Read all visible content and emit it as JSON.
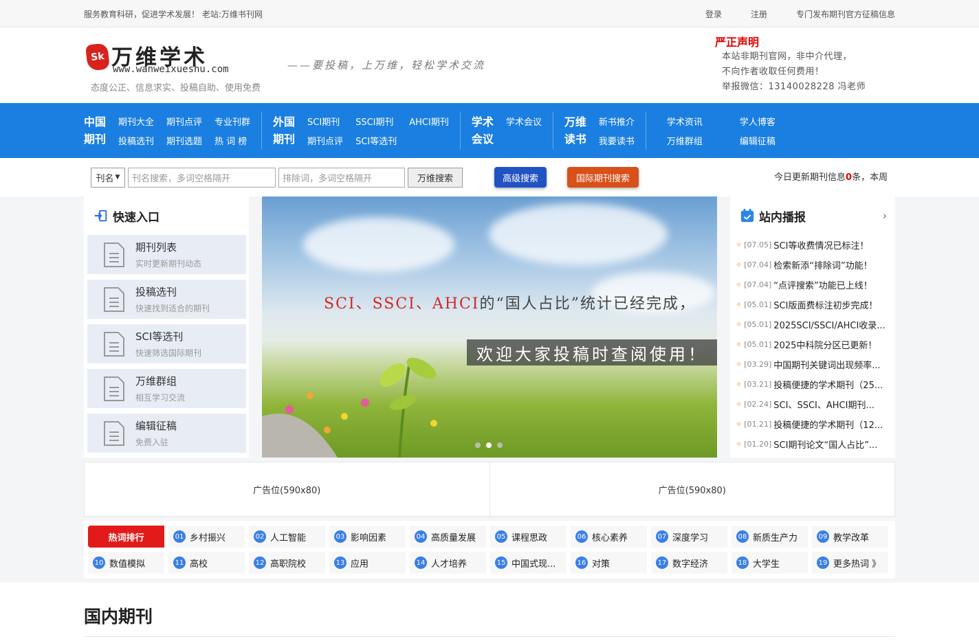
{
  "topbar": {
    "slogan": "服务教育科研，促进学术发展！ 老站:万维书刊网",
    "login": "登录",
    "register": "注册",
    "official": "专门发布期刊官方征稿信息"
  },
  "header": {
    "logo_badge": "Sk",
    "logo_title": "万维学术",
    "logo_url": "www.wanweixueshu.com",
    "logo_slogan": "态度公正、信息求实、投稿自助、使用免费",
    "tagline": "——要投稿，上万维，轻松学术交流",
    "notice_title": "严正声明",
    "notice_lines": [
      "本站非期刊官网，非中介代理，",
      "不向作者收取任何费用！",
      "举报微信：13140028228 冯老师"
    ]
  },
  "nav": {
    "groups": [
      {
        "cat": [
          "中国",
          "期刊"
        ],
        "links": [
          "期刊大全",
          "投稿选刊",
          "期刊点评",
          "期刊选题",
          "专业刊群",
          "热 词 榜"
        ]
      },
      {
        "cat": [
          "外国",
          "期刊"
        ],
        "links": [
          "SCI期刊",
          "期刊点评",
          "SSCI期刊",
          "SCI等选刊",
          "AHCI期刊",
          ""
        ]
      },
      {
        "cat": [
          "学术",
          "会议"
        ],
        "links": [
          "学术会议",
          ""
        ]
      },
      {
        "cat": [
          "万维",
          "读书"
        ],
        "links": [
          "新书推介",
          "我要读书"
        ]
      }
    ],
    "solo": [
      [
        "学术资讯",
        "万维群组"
      ],
      [
        "学人博客",
        "编辑征稿"
      ]
    ]
  },
  "search": {
    "select_value": "刊名",
    "keyword_placeholder": "刊名搜索，多词空格隔开",
    "exclude_placeholder": "排除词，多词空格隔开",
    "search_button": "万维搜索",
    "advanced_button": "高级搜索",
    "intl_button": "国际期刊搜索",
    "update_prefix": "今日更新期刊信息",
    "update_count": "0",
    "update_suffix": "条，本周"
  },
  "quick": {
    "title": "快速入口",
    "items": [
      {
        "title": "期刊列表",
        "sub": "实时更新期刊动态"
      },
      {
        "title": "投稿选刊",
        "sub": "快速找到适合的期刊"
      },
      {
        "title": "SCI等选刊",
        "sub": "快速筛选国际期刊"
      },
      {
        "title": "万维群组",
        "sub": "相互学习交流"
      },
      {
        "title": "编辑征稿",
        "sub": "免费入驻"
      }
    ]
  },
  "banner": {
    "line1_highlight": "SCI、SSCI、AHCI",
    "line1_rest": "的“国人占比”统计已经完成，",
    "line2": "欢迎大家投稿时查阅使用！"
  },
  "news": {
    "title": "站内播报",
    "items": [
      {
        "date": "[07.05]",
        "text": "SCI等收费情况已标注！"
      },
      {
        "date": "[07.04]",
        "text": "检索新添“排除词”功能！"
      },
      {
        "date": "[07.04]",
        "text": "“点评搜索”功能已上线！"
      },
      {
        "date": "[05.01]",
        "text": "SCI版面费标注初步完成！"
      },
      {
        "date": "[05.01]",
        "text": "2025SCI/SSCI/AHCI收录..."
      },
      {
        "date": "[05.01]",
        "text": "2025中科院分区已更新！"
      },
      {
        "date": "[03.29]",
        "text": "中国期刊关键词出现频率..."
      },
      {
        "date": "[03.21]",
        "text": "投稿便捷的学术期刊（25..."
      },
      {
        "date": "[02.24]",
        "text": "SCI、SSCI、AHCI期刊..."
      },
      {
        "date": "[01.21]",
        "text": "投稿便捷的学术期刊（12..."
      },
      {
        "date": "[01.20]",
        "text": "SCI期刊论文“国人占比”..."
      }
    ]
  },
  "ads": [
    "广告位(590x80)",
    "广告位(590x80)"
  ],
  "hot": {
    "title": "热词排行",
    "items": [
      {
        "num": "01",
        "label": "乡村振兴"
      },
      {
        "num": "02",
        "label": "人工智能"
      },
      {
        "num": "03",
        "label": "影响因素"
      },
      {
        "num": "04",
        "label": "高质量发展"
      },
      {
        "num": "05",
        "label": "课程思政"
      },
      {
        "num": "06",
        "label": "核心素养"
      },
      {
        "num": "07",
        "label": "深度学习"
      },
      {
        "num": "08",
        "label": "新质生产力"
      },
      {
        "num": "09",
        "label": "教学改革"
      },
      {
        "num": "10",
        "label": "数值模拟"
      },
      {
        "num": "11",
        "label": "高校"
      },
      {
        "num": "12",
        "label": "高职院校"
      },
      {
        "num": "13",
        "label": "应用"
      },
      {
        "num": "14",
        "label": "人才培养"
      },
      {
        "num": "15",
        "label": "中国式现..."
      },
      {
        "num": "16",
        "label": "对策"
      },
      {
        "num": "17",
        "label": "数字经济"
      },
      {
        "num": "18",
        "label": "大学生"
      },
      {
        "num": "19",
        "label": "更多热词 》"
      }
    ]
  },
  "section": {
    "title": "国内期刊"
  },
  "colors": {
    "nav_bg": "#1a7fe0",
    "notice_red": "#e10000",
    "hot_red": "#e21a1a",
    "adv_btn": "#2253c3",
    "intl_btn": "#d8501a",
    "num_blue": "#3a7fe6"
  }
}
